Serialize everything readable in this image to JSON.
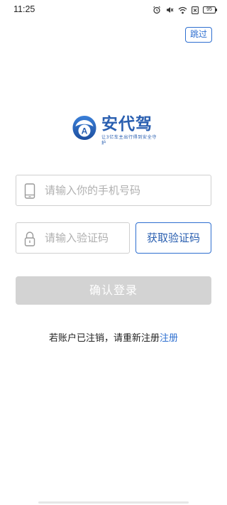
{
  "status_bar": {
    "time": "11:25",
    "battery": "95",
    "icons": [
      "alarm-icon",
      "mute-icon",
      "wifi-icon",
      "sim-icon",
      "battery-icon"
    ]
  },
  "skip_label": "跳过",
  "logo": {
    "emblem_letter": "A",
    "title": "安代驾",
    "tagline": "让3亿车主出行得到安全守护"
  },
  "phone_field": {
    "placeholder": "请输入你的手机号码",
    "value": ""
  },
  "code_field": {
    "placeholder": "请输入验证码",
    "value": ""
  },
  "get_code_label": "获取验证码",
  "login_label": "确认登录",
  "note": {
    "text": "若账户已注销，请重新注册",
    "link": "注册"
  },
  "colors": {
    "accent": "#2e6fd0",
    "disabled": "#d3d3d3",
    "logo": "#2a5fb0"
  }
}
